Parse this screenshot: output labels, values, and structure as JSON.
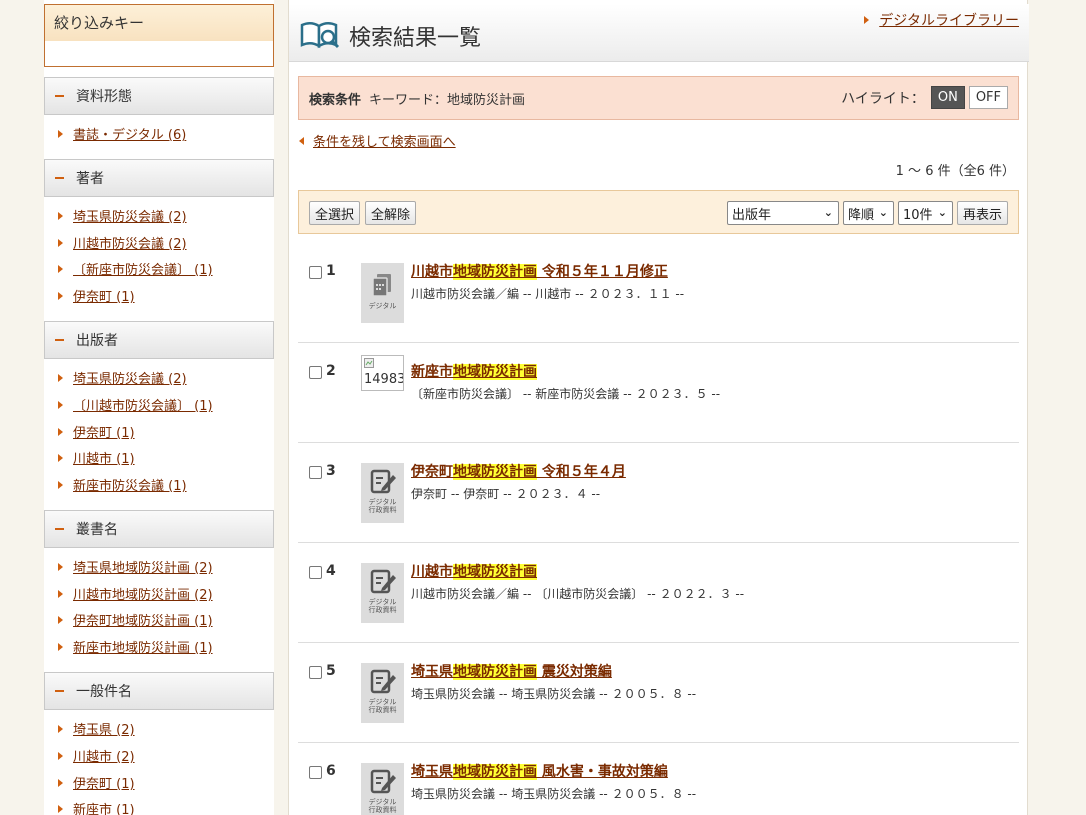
{
  "sidebar": {
    "filter_key_title": "絞り込みキー",
    "facets": [
      {
        "title": "資料形態",
        "items": [
          "書誌・デジタル (6)"
        ]
      },
      {
        "title": "著者",
        "items": [
          "埼玉県防災会議 (2)",
          "川越市防災会議 (2)",
          "〔新座市防災会議〕 (1)",
          "伊奈町 (1)"
        ]
      },
      {
        "title": "出版者",
        "items": [
          "埼玉県防災会議 (2)",
          "〔川越市防災会議〕 (1)",
          "伊奈町 (1)",
          "川越市 (1)",
          "新座市防災会議 (1)"
        ]
      },
      {
        "title": "叢書名",
        "items": [
          "埼玉県地域防災計画 (2)",
          "川越市地域防災計画 (2)",
          "伊奈町地域防災計画 (1)",
          "新座市地域防災計画 (1)"
        ]
      },
      {
        "title": "一般件名",
        "items": [
          "埼玉県 (2)",
          "川越市 (2)",
          "伊奈町 (1)",
          "新座市 (1)"
        ]
      }
    ]
  },
  "header": {
    "title": "検索結果一覧",
    "library_link": "デジタルライブラリー"
  },
  "condition": {
    "label": "検索条件",
    "text": "キーワード：地域防災計画",
    "highlight_label": "ハイライト：",
    "on": "ON",
    "off": "OFF"
  },
  "back_link": "条件を残して検索画面へ",
  "count_text": "1 ～ 6 件（全6 件）",
  "toolbar": {
    "select_all": "全選択",
    "clear_all": "全解除",
    "sort_field": "出版年",
    "sort_order": "降順",
    "per_page": "10件",
    "redisplay": "再表示"
  },
  "thumb_labels": {
    "digital": "デジタル",
    "gov_line1": "デジタル",
    "gov_line2": "行政資料",
    "broken": "14983"
  },
  "results": [
    {
      "num": "1",
      "pre": "川越市",
      "mark": "地域防災計画",
      "post": " 令和５年１１月修正",
      "desc": "川越市防災会議／編 -- 川越市 -- ２０２３．１１ --",
      "thumb": "digital"
    },
    {
      "num": "2",
      "pre": "新座市",
      "mark": "地域防災計画",
      "post": "",
      "desc": "〔新座市防災会議〕 -- 新座市防災会議 -- ２０２３．５ --",
      "thumb": "broken"
    },
    {
      "num": "3",
      "pre": "伊奈町",
      "mark": "地域防災計画",
      "post": " 令和５年４月",
      "desc": "伊奈町 -- 伊奈町 -- ２０２３．４ --",
      "thumb": "gov"
    },
    {
      "num": "4",
      "pre": "川越市",
      "mark": "地域防災計画",
      "post": "",
      "desc": "川越市防災会議／編 -- 〔川越市防災会議〕 -- ２０２２．３ --",
      "thumb": "gov"
    },
    {
      "num": "5",
      "pre": "埼玉県",
      "mark": "地域防災計画",
      "post": " 震災対策編",
      "desc": "埼玉県防災会議 -- 埼玉県防災会議 -- ２００５．８ --",
      "thumb": "gov"
    },
    {
      "num": "6",
      "pre": "埼玉県",
      "mark": "地域防災計画",
      "post": " 風水害・事故対策編",
      "desc": "埼玉県防災会議 -- 埼玉県防災会議 -- ２００５．８ --",
      "thumb": "gov"
    }
  ]
}
